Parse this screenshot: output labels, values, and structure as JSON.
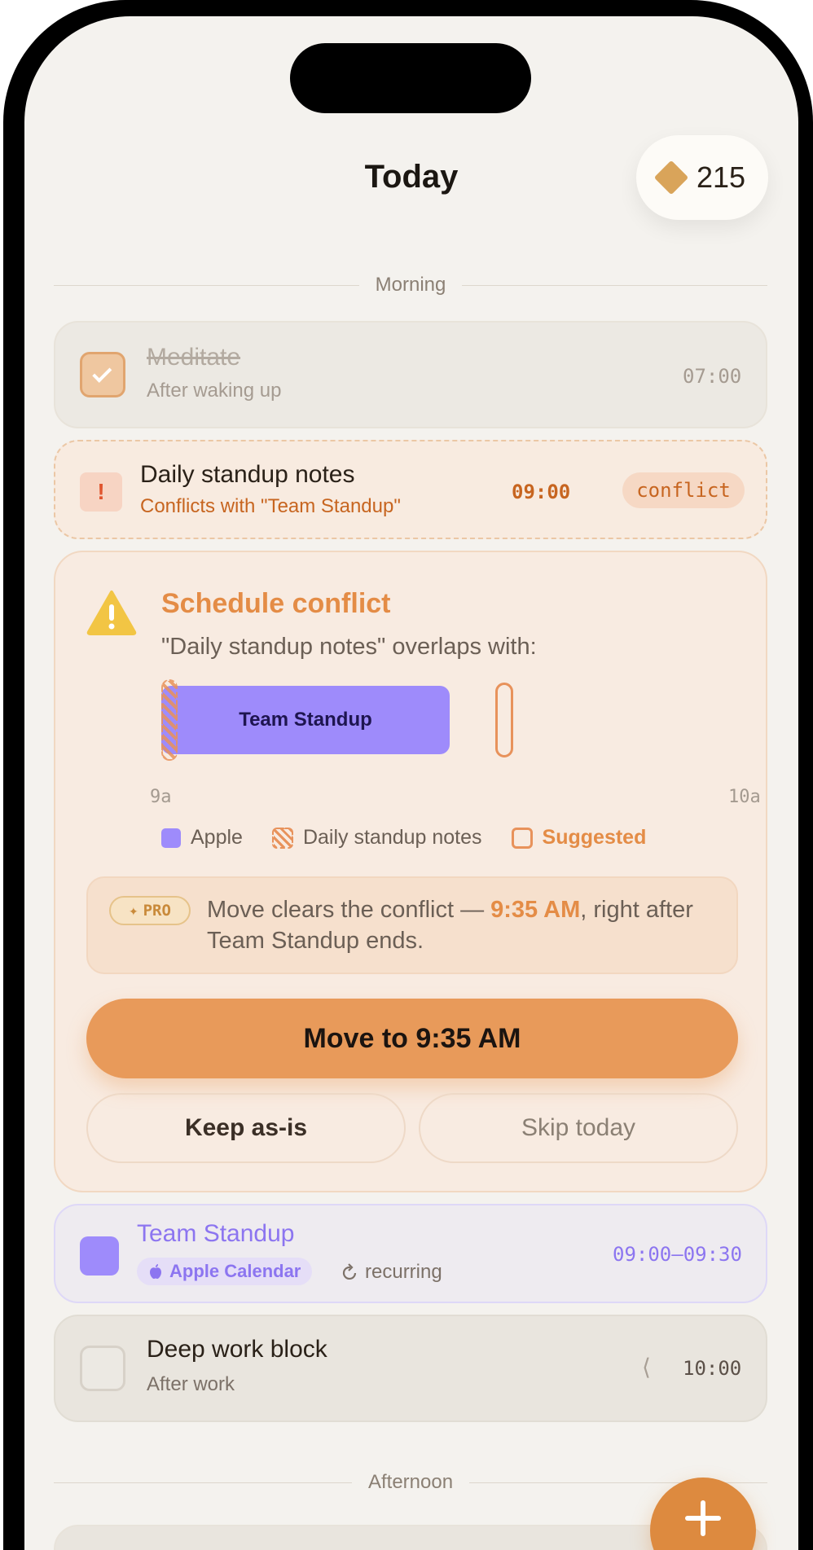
{
  "header": {
    "title": "Today",
    "gem_count": "215",
    "gem_icon": "diamond-icon"
  },
  "sections": {
    "morning": "Morning",
    "afternoon": "Afternoon"
  },
  "tasks": {
    "meditate": {
      "title": "Meditate",
      "subtitle": "After waking up",
      "time": "07:00",
      "done": true
    },
    "standup_notes": {
      "title": "Daily standup notes",
      "subtitle": "Conflicts with \"Team Standup\"",
      "time": "09:00",
      "badge": "conflict",
      "badge_icon_text": "!"
    },
    "standup_event": {
      "title": "Team Standup",
      "calendar": "Apple Calendar",
      "recurrence": "recurring",
      "time": "09:00–09:30"
    },
    "deep_work": {
      "title": "Deep work block",
      "subtitle": "After work",
      "time": "10:00"
    }
  },
  "conflict_panel": {
    "title": "Schedule conflict",
    "description": "\"Daily standup notes\" overlaps with:",
    "timeline": {
      "event_label": "Team Standup",
      "start_tick": "9a",
      "end_tick": "10a"
    },
    "legend": {
      "apple": "Apple",
      "task": "Daily standup notes",
      "suggested": "Suggested"
    },
    "pro": {
      "badge": "PRO",
      "badge_star": "✦",
      "text_before": "Move clears the conflict — ",
      "highlight": "9:35 AM",
      "text_after": ", right after Team Standup ends."
    },
    "primary_button": "Move to 9:35 AM",
    "keep_button": "Keep as-is",
    "skip_button": "Skip today"
  },
  "colors": {
    "accent_orange": "#e89a5a",
    "apple_purple": "#9e8bfb",
    "warning_yellow": "#f2c544",
    "background": "#f4f2ee"
  },
  "icons": {
    "fab": "plus-icon",
    "recurring": "refresh-icon",
    "calendar": "apple-icon",
    "warning": "warning-triangle-icon",
    "chevron": "chevron-left-icon"
  }
}
